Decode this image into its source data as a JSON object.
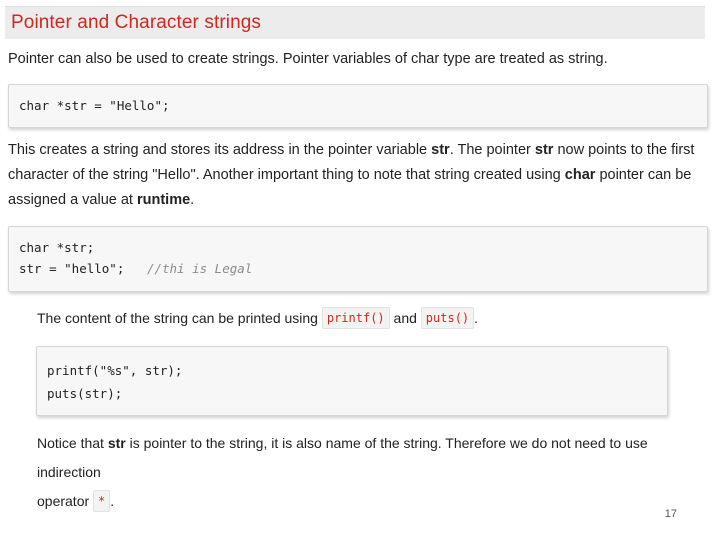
{
  "title": "Pointer and Character strings",
  "intro": "Pointer can also be used to create strings. Pointer variables of char type are treated as string.",
  "code1": [
    "char *str = \"Hello\";"
  ],
  "para2": {
    "line1_a": "This creates a string and stores its address in the pointer variable ",
    "line1_b": "str",
    "line1_c": ". The pointer ",
    "line1_d": "str",
    "line1_e": " now points to the first",
    "line2_a": "character of the string \"Hello\". Another important thing to note that string created using ",
    "line2_b": "char",
    "line2_c": " pointer can be",
    "line3_a": "assigned a value at ",
    "line3_b": "runtime",
    "line3_c": "."
  },
  "code2": {
    "line1": "char *str;",
    "line2_code": "str = \"hello\";   ",
    "line2_comment": "//thi is Legal"
  },
  "para3": {
    "text_a": "The content of the string can be printed using ",
    "code_a": "printf()",
    "text_b": " and ",
    "code_b": "puts()",
    "text_c": "."
  },
  "code3": [
    "printf(\"%s\", str);",
    "puts(str);"
  ],
  "para4": {
    "line1_a": "Notice that ",
    "line1_b": "str",
    "line1_c": " is pointer to the string, it is also name of the string. Therefore we do not need to use indirection",
    "line2_a": "operator ",
    "line2_code": "*",
    "line2_b": "."
  },
  "page_number": "17"
}
